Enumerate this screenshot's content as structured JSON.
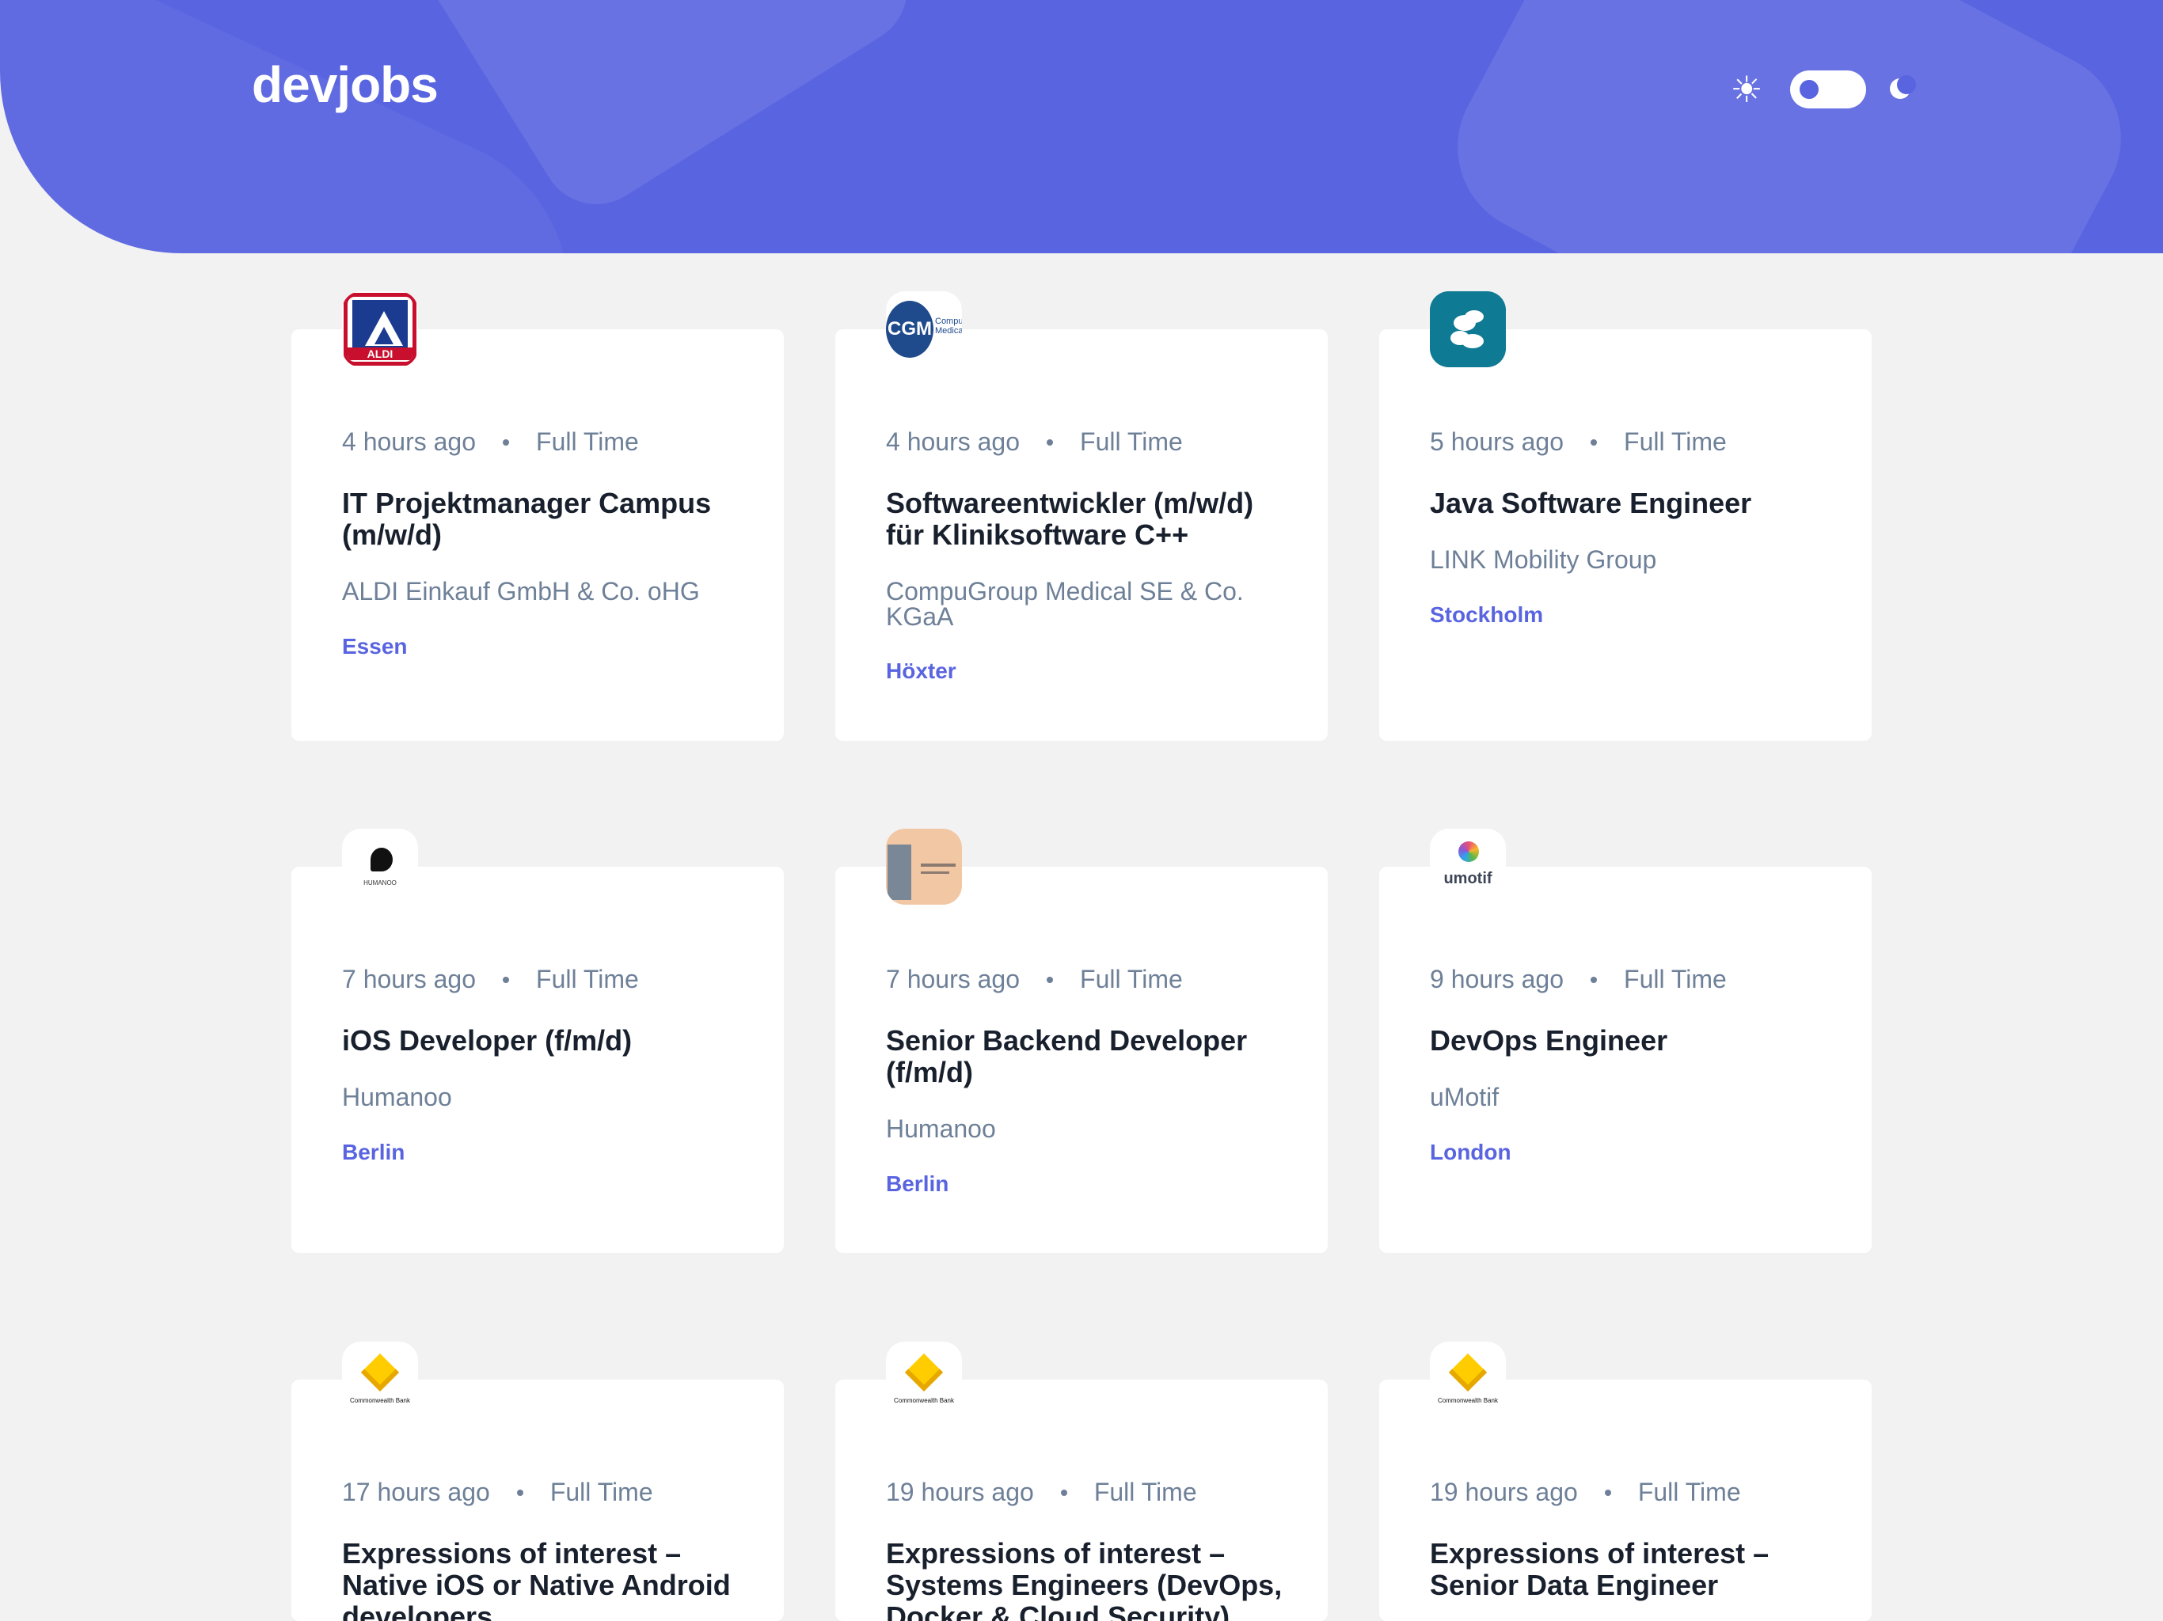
{
  "app": {
    "logo": "devjobs",
    "theme_toggle": {
      "light_icon": "sun-icon",
      "dark_icon": "moon-icon",
      "state": "light"
    }
  },
  "colors": {
    "accent": "#5964e0",
    "background": "#f2f2f2",
    "card": "#ffffff",
    "title": "#19202d",
    "muted": "#6e8098"
  },
  "jobs": [
    {
      "posted": "4 hours ago",
      "contract": "Full Time",
      "title": "IT Projektmanager Campus (m/w/d)",
      "company": "ALDI Einkauf GmbH & Co. oHG",
      "location": "Essen",
      "logo": "aldi-logo",
      "logo_text": "ALDI"
    },
    {
      "posted": "4 hours ago",
      "contract": "Full Time",
      "title": "Softwareentwickler (m/w/d) für Kliniksoftware C++",
      "company": "CompuGroup Medical SE & Co. KGaA",
      "location": "Höxter",
      "logo": "compugroup-logo",
      "logo_text": "CGM",
      "logo_subtext": "Compu Medica"
    },
    {
      "posted": "5 hours ago",
      "contract": "Full Time",
      "title": "Java Software Engineer",
      "company": "LINK Mobility Group",
      "location": "Stockholm",
      "logo": "link-mobility-logo"
    },
    {
      "posted": "7 hours ago",
      "contract": "Full Time",
      "title": "iOS Developer (f/m/d)",
      "company": "Humanoo",
      "location": "Berlin",
      "logo": "humanoo-logo",
      "logo_text": "HUMANOO"
    },
    {
      "posted": "7 hours ago",
      "contract": "Full Time",
      "title": "Senior Backend Developer (f/m/d)",
      "company": "Humanoo",
      "location": "Berlin",
      "logo": "humanoo-photo-logo"
    },
    {
      "posted": "9 hours ago",
      "contract": "Full Time",
      "title": "DevOps Engineer",
      "company": "uMotif",
      "location": "London",
      "logo": "umotif-logo",
      "logo_text": "umotif"
    },
    {
      "posted": "17 hours ago",
      "contract": "Full Time",
      "title": "Expressions of interest – Native iOS or Native Android developers",
      "company": "",
      "location": "",
      "logo": "commonwealth-bank-logo",
      "logo_text": "Commonwealth Bank"
    },
    {
      "posted": "19 hours ago",
      "contract": "Full Time",
      "title": "Expressions of interest – Systems Engineers (DevOps, Docker & Cloud Security)",
      "company": "",
      "location": "",
      "logo": "commonwealth-bank-logo",
      "logo_text": "Commonwealth Bank"
    },
    {
      "posted": "19 hours ago",
      "contract": "Full Time",
      "title": "Expressions of interest – Senior Data Engineer",
      "company": "",
      "location": "",
      "logo": "commonwealth-bank-logo",
      "logo_text": "Commonwealth Bank"
    }
  ]
}
